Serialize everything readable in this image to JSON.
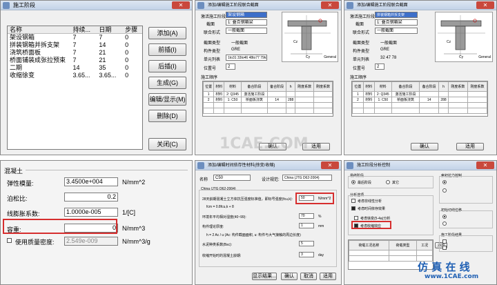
{
  "w1": {
    "title": "施工阶段",
    "cols": [
      "名称",
      "持续...",
      "日期",
      "步骤"
    ],
    "rows": [
      [
        "架设钢箱",
        "7",
        "7",
        "0"
      ],
      [
        "拼装钢箱并拆支架",
        "7",
        "14",
        "0"
      ],
      [
        "浇筑桥面板",
        "7",
        "21",
        "0"
      ],
      [
        "桥面铺装成张拉预束",
        "7",
        "21",
        "0"
      ],
      [
        "二期",
        "14",
        "35",
        "0"
      ],
      [
        "收缩徐变",
        "3.65...",
        "3.65...",
        "0"
      ]
    ],
    "buttons": [
      "添加(A)",
      "前插(I)",
      "后插(I)",
      "生成(G)",
      "编辑/显示(M)",
      "删除(D)",
      "关闭(C)"
    ]
  },
  "w2": {
    "title": "混凝土",
    "f1": "弹性模量:",
    "v1": "3.4500e+004",
    "u1": "N/mm^2",
    "f2": "泊松比:",
    "v2": "0.2",
    "f3": "线膨胀系数:",
    "v3": "1.0000e-005",
    "u3": "1/[C]",
    "f4": "容重:",
    "v4": "0",
    "u4": "N/mm^3",
    "f5": "使用质量密度:",
    "v5": "2.549e-009",
    "u5": "N/mm^3/g"
  },
  "w3": {
    "title": "添加/编辑施工阶段联合截面",
    "l1": "激活施工阶段",
    "v1": "架设钢箱",
    "l2": "截面",
    "v2": "1: 叠合钢箱梁",
    "l3": "联合形式",
    "v3": "一般截面",
    "l4": "截面类型",
    "v4": "一般截面",
    "l5": "构件类型",
    "v5": "GRE",
    "l6": "单元列表",
    "v6": "1to31 33to46 48to77 79to",
    "l7": "位置号",
    "v7": "2",
    "grp": "施工顺序",
    "hdr": [
      "位置",
      "材料",
      "材料",
      "备合阶段",
      "备合阶段",
      "h",
      "刚度系数",
      "刚度系数"
    ],
    "r1": [
      "1",
      "材料",
      "2: Q345",
      "激活施工阶段",
      "",
      "",
      "",
      ""
    ],
    "r2": [
      "2",
      "材料",
      "1: C50",
      "桥面板浇筑",
      "14",
      "288",
      "",
      ""
    ],
    "ok": "确认",
    "apply": "适用",
    "general": "General",
    "cz": "Cz",
    "cy": "Cy"
  },
  "w4": {
    "title": "添加/编辑施工阶段联合截面",
    "v1": "拼装钢箱并拆支架",
    "v2": "1: 叠合钢箱梁",
    "v3": "一般截面",
    "v4": "一般截面",
    "v5": "GRE",
    "v6": "32 47 78",
    "v7": "2",
    "r1": [
      "1",
      "材料",
      "2: Q345",
      "激活施工阶段",
      "",
      "",
      "",
      ""
    ],
    "r2": [
      "2",
      "材料",
      "1: C50",
      "桥面板浇筑",
      "14",
      "288",
      "",
      ""
    ]
  },
  "w5": {
    "title": "添加/编辑时间依存性材料(徐变/收缩)",
    "name_l": "名称",
    "name_v": "C50",
    "code_l": "设计规范:",
    "code_v": "China (JTG D62-2004)",
    "sub": "China (JTG D62-2004)",
    "l1": "28天龄期混凝土立方体抗压强度标准值，即标号强度(fcu,k):",
    "v1": "50",
    "u1": "N/mm^2",
    "l1b": "fcm = 0.8fcu,k + 8",
    "l2": "环境年平均相对湿度(40~99):",
    "v2": "70",
    "u2": "%",
    "l3": "构件理论厚度:",
    "v3": "1",
    "u3": "mm",
    "l3b": "h = 2 Ac / u (Ac: 构件截面面积, u: 构件与大气接触的周边长度)",
    "l4": "水泥种类系数(Bsc):",
    "v4": "5",
    "l5": "收缩开始时的混凝土龄期:",
    "v5": "3",
    "u5": "day",
    "b1": "显示结果...",
    "b2": "确认",
    "b3": "取消",
    "b4": "适用"
  },
  "w6": {
    "title": "施工阶段分析控制",
    "g1": "最终阶段",
    "o1": "最后阶段",
    "o2": "其它",
    "g2": "分析选项",
    "o3": "考虑非线性分析",
    "o4": "考虑时间依存效果",
    "o5": "考虑徐变(5-4a)分析",
    "o6": "考虑收缩效应",
    "ft1": "荷载工况名称",
    "ft2": "荷载类型",
    "ft3": "工况",
    "rg1": "索初拉力控制",
    "rg2": "初始切线位移",
    "rg3": "施工阶段结果",
    "add": "添加"
  },
  "watermark": {
    "line1": "仿 真 在 线",
    "line2": "www.1CAE.com",
    "center": "1CAE.COM"
  }
}
